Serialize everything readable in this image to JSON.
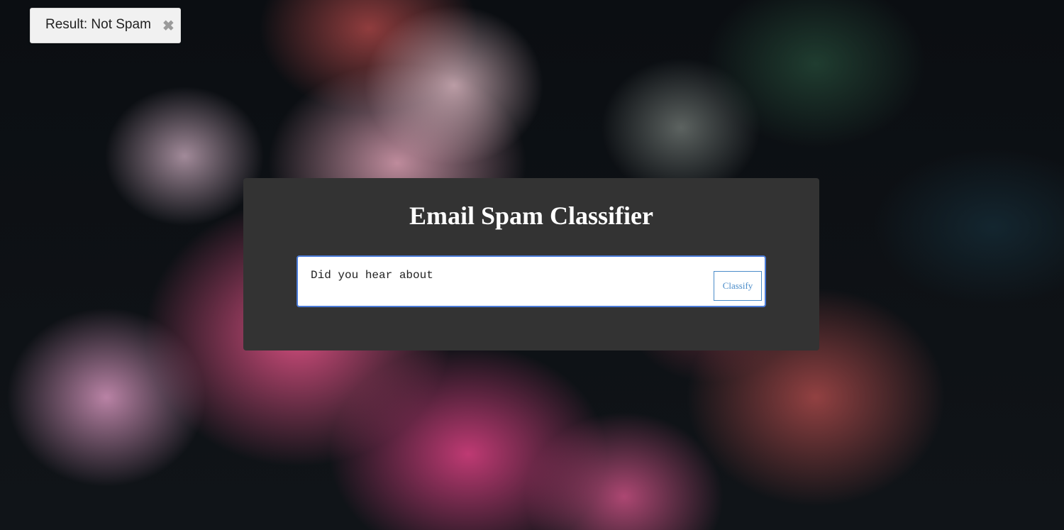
{
  "result_toast": {
    "text": "Result: Not Spam",
    "close_glyph": "✖"
  },
  "classifier": {
    "title": "Email Spam Classifier",
    "message_value": "Did you hear about",
    "classify_label": "Classify"
  },
  "colors": {
    "card_background": "#333333",
    "input_border": "#4a7bd8",
    "button_accent": "#4a8cc9"
  }
}
